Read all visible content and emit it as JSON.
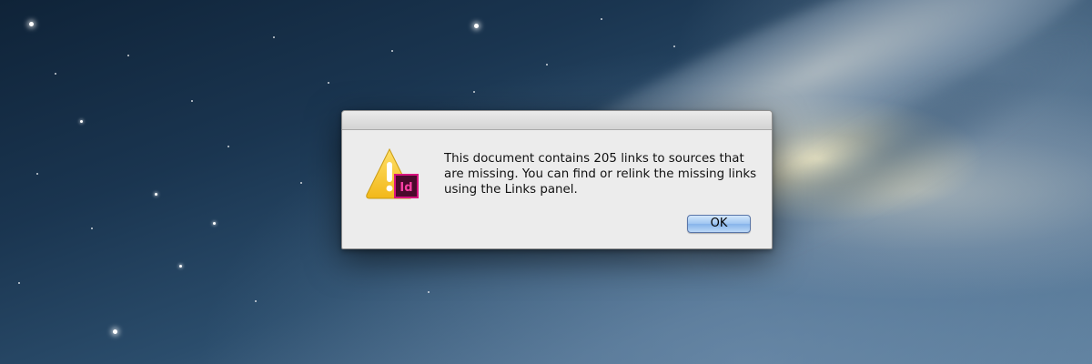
{
  "dialog": {
    "message": "This document contains 205 links to sources that are missing. You can find or relink the missing links using the Links panel.",
    "ok_label": "OK",
    "icon": "alert-warning-indesign-icon",
    "app_badge": "Id"
  },
  "colors": {
    "warning_yellow": "#f6c928",
    "indesign_pink": "#d8137e",
    "indesign_bg": "#4a0a2c",
    "button_blue": "#86b4ea"
  }
}
